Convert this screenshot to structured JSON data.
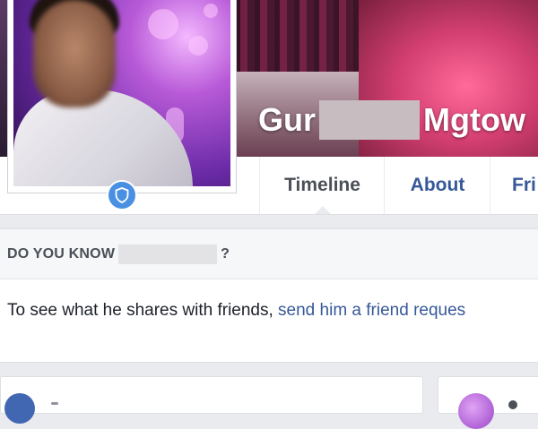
{
  "profile": {
    "name_first": "Gur",
    "name_last": "Mgtow"
  },
  "tabs": [
    {
      "label": "Timeline",
      "active": true
    },
    {
      "label": "About",
      "active": false
    },
    {
      "label": "Fri",
      "active": false
    }
  ],
  "know_section": {
    "heading_prefix": "DO YOU KNOW",
    "heading_suffix": "?",
    "body_text": "To see what he shares with friends, ",
    "link_text": "send him a friend reques"
  },
  "icons": {
    "badge": "shield-icon"
  },
  "colors": {
    "link": "#365899",
    "badge": "#4a90e2",
    "background": "#e9ebee"
  }
}
